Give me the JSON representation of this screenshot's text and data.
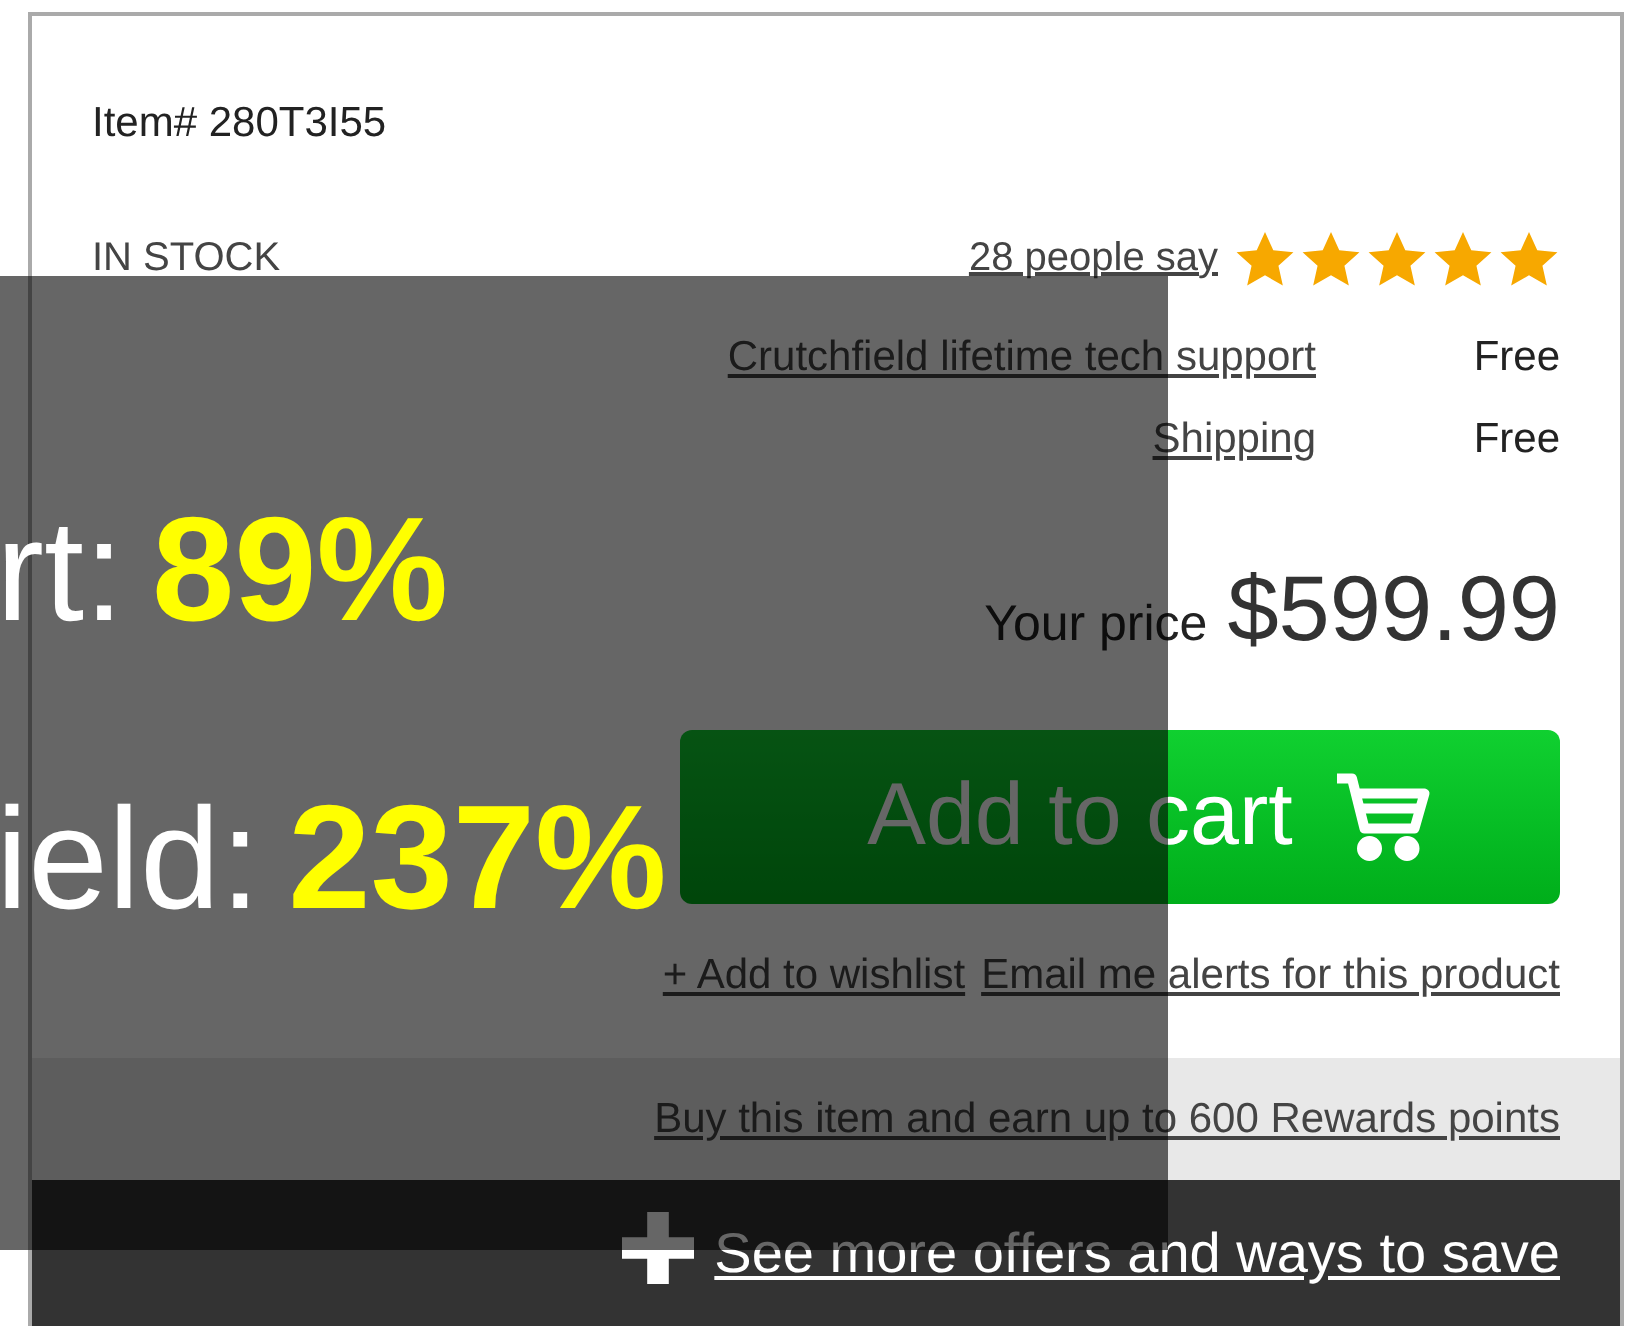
{
  "product": {
    "item_number": "Item# 280T3I55",
    "stock": "IN STOCK",
    "reviews_link": "28 people say",
    "stars": 5,
    "services": [
      {
        "label": "Crutchfield lifetime tech support",
        "price": "Free"
      },
      {
        "label": "Shipping",
        "price": "Free"
      }
    ],
    "price_label": "Your price",
    "price": "$599.99",
    "cart_button": "Add to cart",
    "wishlist_link": "+ Add to wishlist",
    "alerts_link": "Email me alerts for this product",
    "rewards_link": "Buy this item and earn up to 600 Rewards points",
    "offers_link": "See more offers and ways to save"
  },
  "overlay": {
    "stats": [
      {
        "label": "rt:",
        "value": "89%"
      },
      {
        "label": "ield:",
        "value": "237%"
      }
    ]
  }
}
